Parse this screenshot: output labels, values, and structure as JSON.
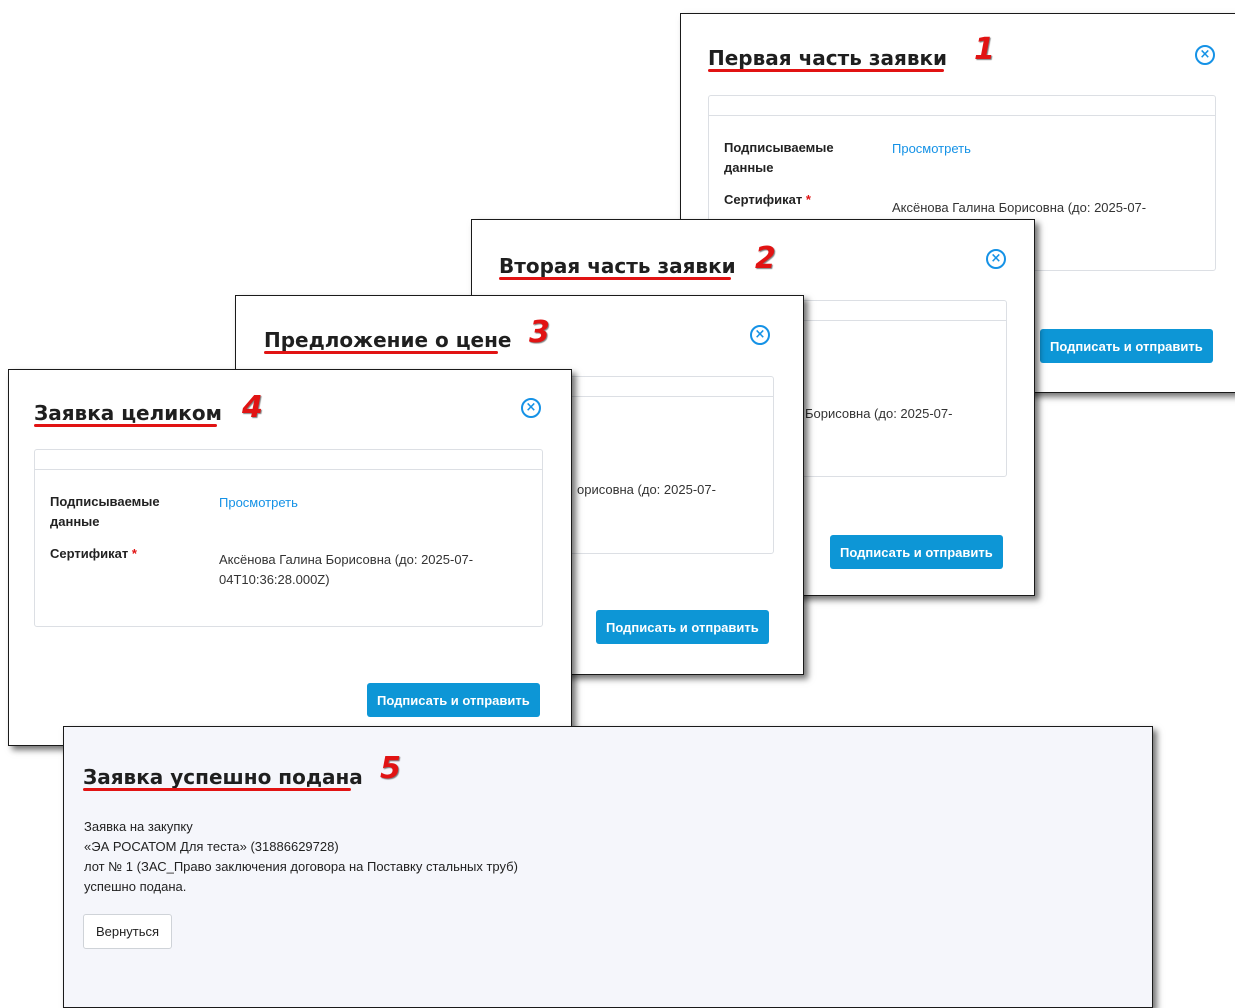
{
  "dialogs": {
    "d1": {
      "title": "Первая часть заявки",
      "number": "1",
      "data_label": "Подписываемые данные",
      "view_link": "Просмотреть",
      "cert_label": "Сертификат",
      "cert_value": "Аксёнова Галина Борисовна (до: 2025-07-",
      "submit_label": "Подписать и отправить"
    },
    "d2": {
      "title": "Вторая часть заявки",
      "number": "2",
      "cert_value_fragment": "Борисовна (до: 2025-07-",
      "submit_label": "Подписать и отправить"
    },
    "d3": {
      "title": "Предложение о цене",
      "number": "3",
      "cert_value_fragment": "орисовна (до: 2025-07-",
      "submit_label": "Подписать и отправить"
    },
    "d4": {
      "title": "Заявка целиком",
      "number": "4",
      "data_label": "Подписываемые данные",
      "view_link": "Просмотреть",
      "cert_label": "Сертификат",
      "cert_value_line1": "Аксёнова Галина Борисовна (до: 2025-07-",
      "cert_value_line2": "04T10:36:28.000Z)",
      "submit_label": "Подписать и отправить"
    }
  },
  "success": {
    "title": "Заявка успешно подана",
    "number": "5",
    "message_lines": [
      "Заявка на закупку",
      "«ЭА РОСАТОМ Для теста» (31886629728)",
      "лот № 1 (ЗАС_Право заключения договора на Поставку стальных труб)",
      "успешно подана."
    ],
    "back_label": "Вернуться"
  },
  "required_mark": "*",
  "close_glyph": "×",
  "colors": {
    "accent": "#0d96d6",
    "link": "#1592e6",
    "annotation_red": "#e11313"
  }
}
